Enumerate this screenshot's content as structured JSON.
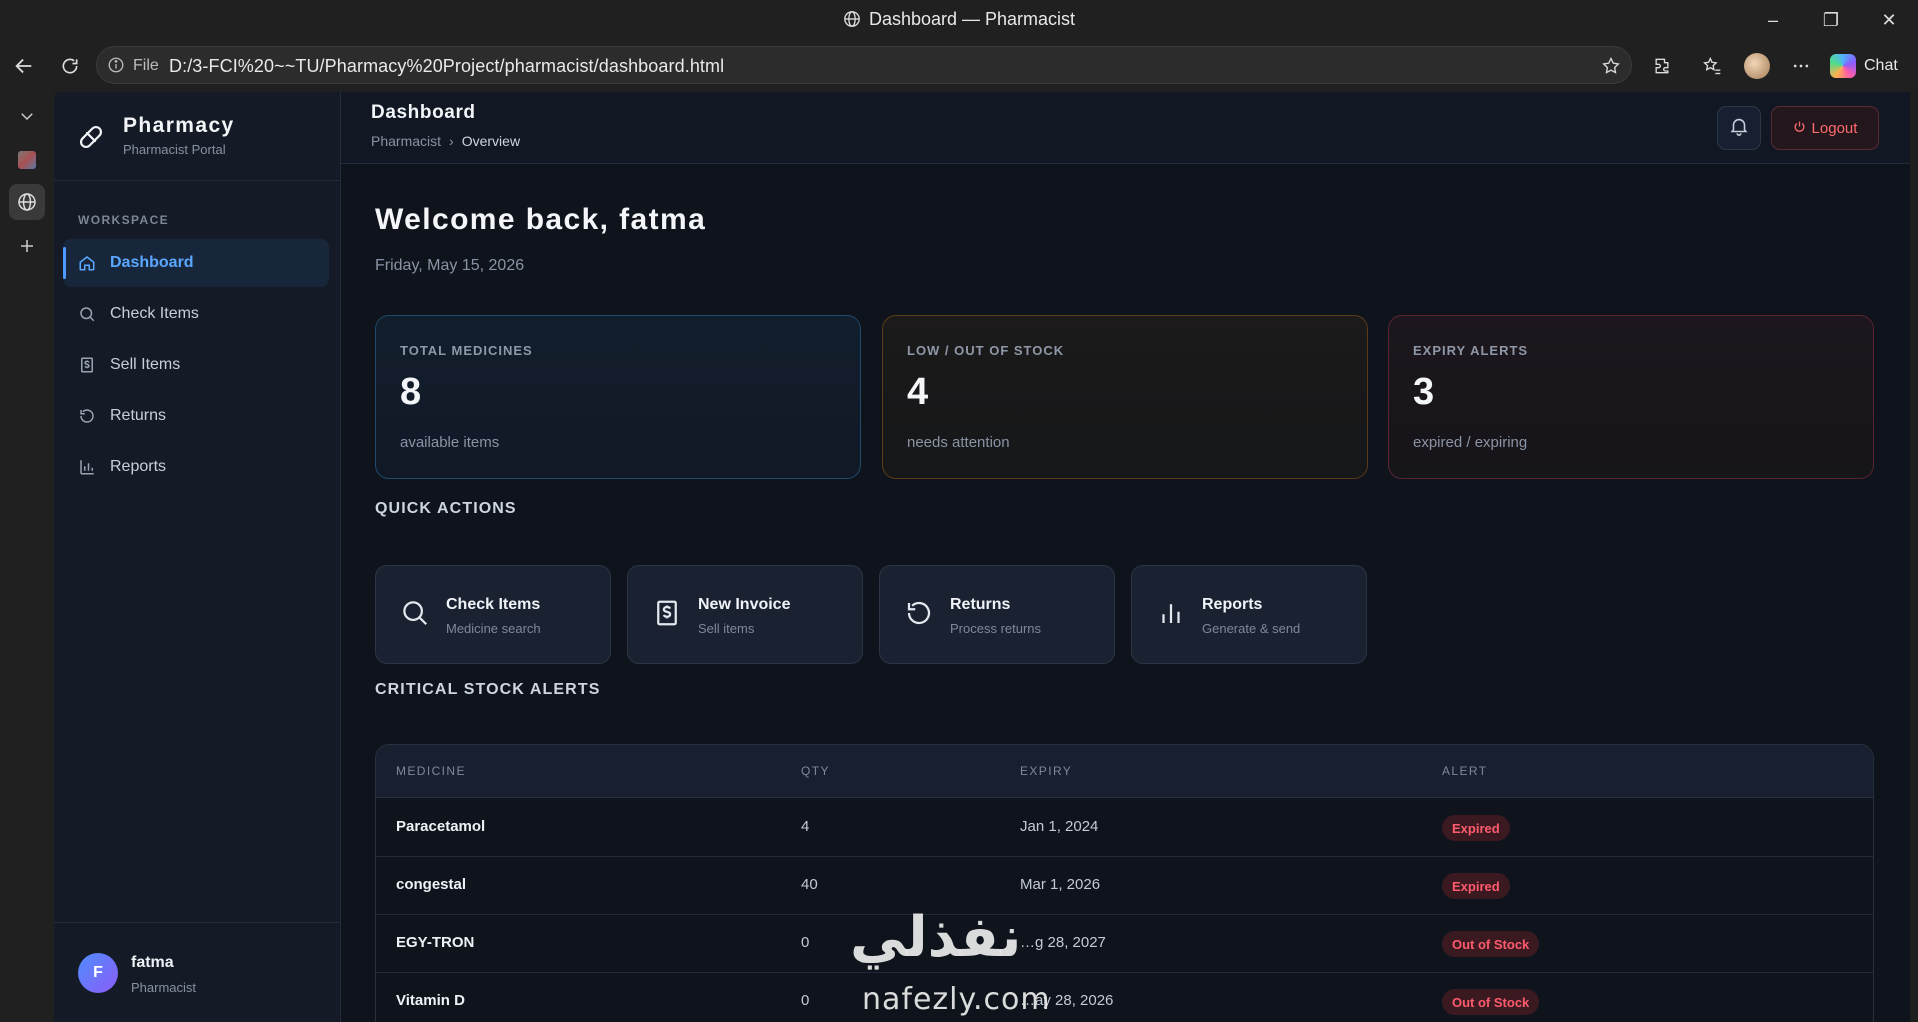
{
  "browser": {
    "window_title": "Dashboard — Pharmacist",
    "file_label": "File",
    "url": "D:/3-FCI%20~~TU/Pharmacy%20Project/pharmacist/dashboard.html",
    "chat_label": "Chat"
  },
  "sidebar": {
    "brand_name": "Pharmacy",
    "brand_sub": "Pharmacist Portal",
    "section_label": "WORKSPACE",
    "items": [
      {
        "label": "Dashboard",
        "icon": "home-icon"
      },
      {
        "label": "Check Items",
        "icon": "search-icon"
      },
      {
        "label": "Sell Items",
        "icon": "invoice-icon"
      },
      {
        "label": "Returns",
        "icon": "undo-icon"
      },
      {
        "label": "Reports",
        "icon": "bar-chart-icon"
      }
    ],
    "user": {
      "initial": "F",
      "name": "fatma",
      "role": "Pharmacist"
    }
  },
  "topbar": {
    "title": "Dashboard",
    "crumb_root": "Pharmacist",
    "crumb_sep": "›",
    "crumb_current": "Overview",
    "logout_label": "Logout"
  },
  "main": {
    "welcome": "Welcome back, fatma",
    "date": "Friday, May 15, 2026",
    "stats": [
      {
        "label": "TOTAL MEDICINES",
        "value": "8",
        "hint": "available items",
        "color": "#1f4a6b"
      },
      {
        "label": "LOW / OUT OF STOCK",
        "value": "4",
        "hint": "needs attention",
        "color": "#5e3b18"
      },
      {
        "label": "EXPIRY ALERTS",
        "value": "3",
        "hint": "expired / expiring",
        "color": "#5b2331"
      }
    ],
    "quick_actions_title": "QUICK ACTIONS",
    "quick_actions": [
      {
        "title": "Check Items",
        "sub": "Medicine search",
        "icon": "search-icon"
      },
      {
        "title": "New Invoice",
        "sub": "Sell items",
        "icon": "invoice-icon"
      },
      {
        "title": "Returns",
        "sub": "Process returns",
        "icon": "undo-icon"
      },
      {
        "title": "Reports",
        "sub": "Generate & send",
        "icon": "bar-chart-icon"
      }
    ],
    "alerts_title": "CRITICAL STOCK ALERTS",
    "table": {
      "headers": [
        "MEDICINE",
        "QTY",
        "EXPIRY",
        "ALERT"
      ],
      "rows": [
        {
          "medicine": "Paracetamol",
          "qty": "4",
          "expiry": "Jan 1, 2024",
          "alert": "Expired"
        },
        {
          "medicine": "congestal",
          "qty": "40",
          "expiry": "Mar 1, 2026",
          "alert": "Expired"
        },
        {
          "medicine": "EGY-TRON",
          "qty": "0",
          "expiry": "…g 28, 2027",
          "alert": "Out of Stock"
        },
        {
          "medicine": "Vitamin D",
          "qty": "0",
          "expiry": "…ay 28, 2026",
          "alert": "Out of Stock"
        }
      ]
    }
  },
  "watermark": {
    "arabic": "نفذلي",
    "latin": "nafezly.com"
  },
  "colors": {
    "accent": "#5aa7ff",
    "danger": "#ff5b6e",
    "bg": "#0f141c"
  }
}
